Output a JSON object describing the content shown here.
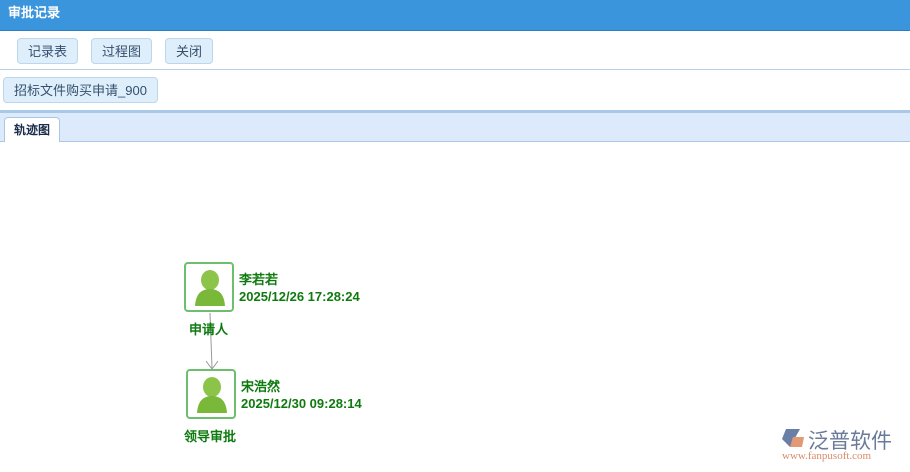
{
  "window": {
    "title": "审批记录"
  },
  "toolbar": {
    "record_table": "记录表",
    "process_chart": "过程图",
    "close": "关闭"
  },
  "document": {
    "name": "招标文件购买申请_900"
  },
  "tabs": [
    {
      "label": "轨迹图"
    }
  ],
  "flow": [
    {
      "name": "李若若",
      "time": "2025/12/26 17:28:24",
      "role": "申请人"
    },
    {
      "name": "宋浩然",
      "time": "2025/12/30 09:28:14",
      "role": "领导审批"
    }
  ],
  "watermark": {
    "brand": "泛普软件",
    "url": "www.fanpusoft.com"
  }
}
